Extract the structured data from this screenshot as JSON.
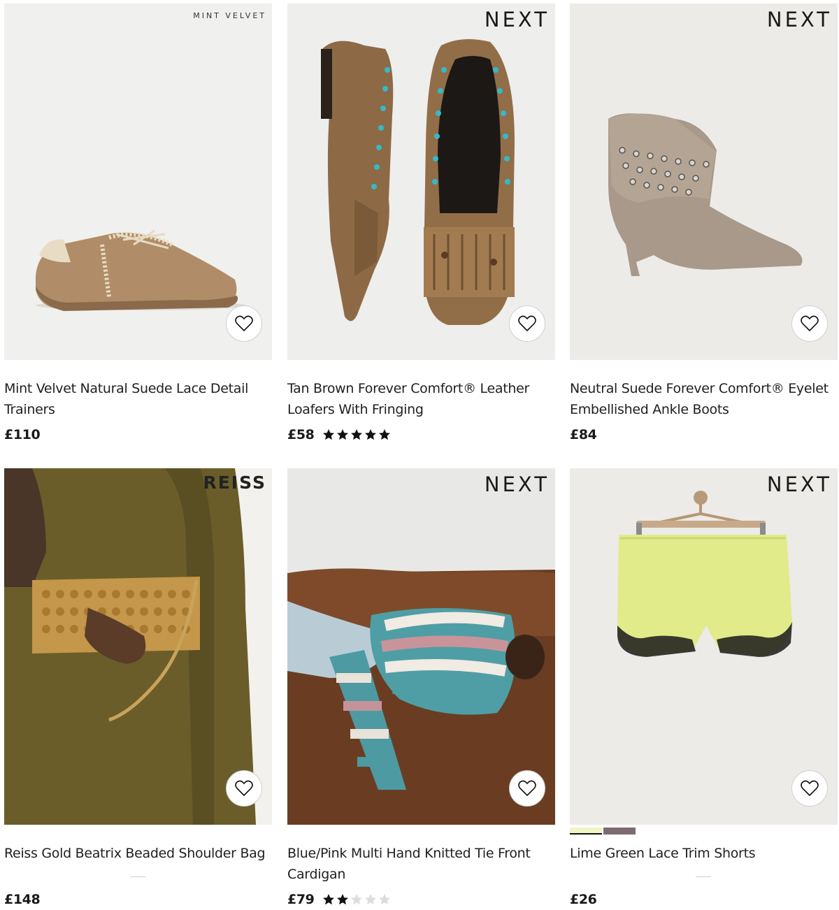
{
  "products": [
    {
      "brand": "MINT VELVET",
      "title_line1": "Mint Velvet Natural Suede Lace Detail",
      "title_line2": "Trainers",
      "price": "£110",
      "rating": 0,
      "favourite_label": "Add to favourites"
    },
    {
      "brand": "NEXT",
      "title_line1": "Tan Brown Forever Comfort® Leather",
      "title_line2": "Loafers With Fringing",
      "price": "£58",
      "rating": 5,
      "favourite_label": "Add to favourites"
    },
    {
      "brand": "NEXT",
      "title_line1": "Neutral Suede Forever Comfort® Eyelet",
      "title_line2": "Embellished Ankle Boots",
      "price": "£84",
      "rating": 0,
      "favourite_label": "Add to favourites"
    },
    {
      "brand": "REISS",
      "title_line1": "Reiss Gold Beatrix Beaded Shoulder Bag",
      "title_line2": "",
      "price": "£148",
      "rating": 0,
      "favourite_label": "Add to favourites"
    },
    {
      "brand": "NEXT",
      "title_line1": "Blue/Pink Multi Hand Knitted Tie Front",
      "title_line2": "Cardigan",
      "price": "£79",
      "rating": 2,
      "favourite_label": "Add to favourites"
    },
    {
      "brand": "NEXT",
      "title_line1": "Lime Green Lace Trim Shorts",
      "title_line2": "",
      "price": "£26",
      "rating": 0,
      "favourite_label": "Add to favourites",
      "swatches": [
        "#f2f5c4",
        "#7d6a72"
      ]
    }
  ],
  "colors": {
    "star_filled": "#111111",
    "star_empty": "#dcdcdc"
  }
}
